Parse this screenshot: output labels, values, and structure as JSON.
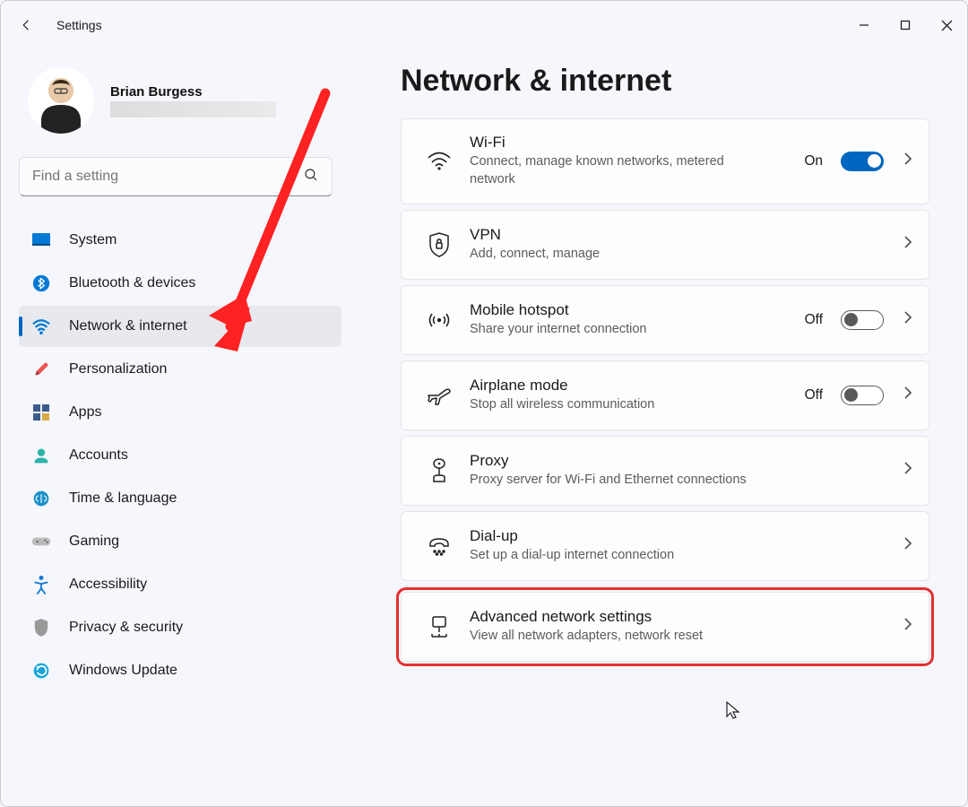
{
  "app_title": "Settings",
  "user": {
    "name": "Brian Burgess"
  },
  "search": {
    "placeholder": "Find a setting"
  },
  "nav": {
    "items": [
      {
        "label": "System",
        "icon": "system"
      },
      {
        "label": "Bluetooth & devices",
        "icon": "bluetooth"
      },
      {
        "label": "Network & internet",
        "icon": "network",
        "active": true
      },
      {
        "label": "Personalization",
        "icon": "paint"
      },
      {
        "label": "Apps",
        "icon": "apps"
      },
      {
        "label": "Accounts",
        "icon": "accounts"
      },
      {
        "label": "Time & language",
        "icon": "time"
      },
      {
        "label": "Gaming",
        "icon": "gaming"
      },
      {
        "label": "Accessibility",
        "icon": "accessibility"
      },
      {
        "label": "Privacy & security",
        "icon": "privacy"
      },
      {
        "label": "Windows Update",
        "icon": "update"
      }
    ]
  },
  "page": {
    "title": "Network & internet",
    "cards": [
      {
        "id": "wifi",
        "title": "Wi-Fi",
        "desc": "Connect, manage known networks, metered network",
        "state_label": "On",
        "toggle": "on"
      },
      {
        "id": "vpn",
        "title": "VPN",
        "desc": "Add, connect, manage"
      },
      {
        "id": "hotspot",
        "title": "Mobile hotspot",
        "desc": "Share your internet connection",
        "state_label": "Off",
        "toggle": "off"
      },
      {
        "id": "airplane",
        "title": "Airplane mode",
        "desc": "Stop all wireless communication",
        "state_label": "Off",
        "toggle": "off"
      },
      {
        "id": "proxy",
        "title": "Proxy",
        "desc": "Proxy server for Wi-Fi and Ethernet connections"
      },
      {
        "id": "dialup",
        "title": "Dial-up",
        "desc": "Set up a dial-up internet connection"
      },
      {
        "id": "advanced",
        "title": "Advanced network settings",
        "desc": "View all network adapters, network reset",
        "highlight": true
      }
    ]
  }
}
